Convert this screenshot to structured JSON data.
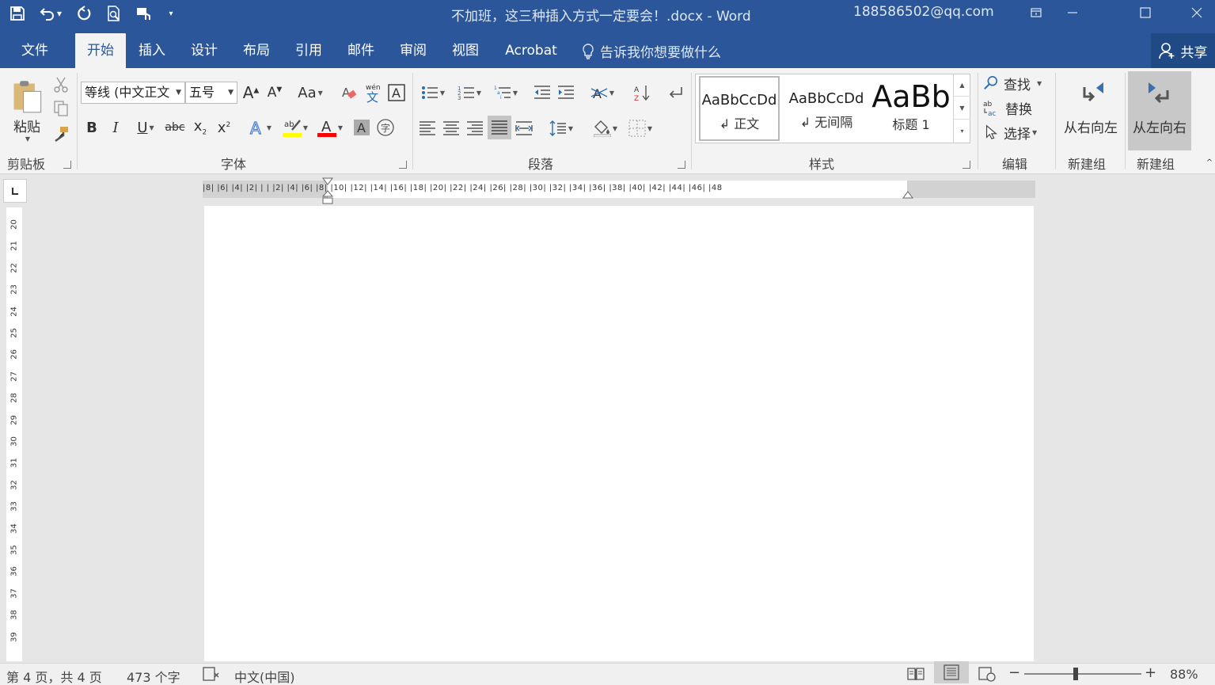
{
  "titlebar": {
    "document_title": "不加班，这三种插入方式一定要会！.docx  -  Word",
    "user_email": "188586502@qq.com",
    "qat_icons": [
      "save-icon",
      "undo-icon",
      "redo-icon",
      "print-preview-icon",
      "touch-mode-icon",
      "customize-qat-icon"
    ]
  },
  "tabs": {
    "file": "文件",
    "home": "开始",
    "insert": "插入",
    "design": "设计",
    "layout": "布局",
    "references": "引用",
    "mailings": "邮件",
    "review": "审阅",
    "view": "视图",
    "acrobat": "Acrobat",
    "tell_me": "告诉我你想要做什么",
    "share": "共享"
  },
  "ribbon": {
    "clipboard": {
      "paste": "粘贴",
      "label": "剪贴板"
    },
    "font": {
      "font_name": "等线 (中文正文",
      "font_size": "五号",
      "case_label": "Aa",
      "label": "字体"
    },
    "paragraph": {
      "label": "段落"
    },
    "styles": {
      "items": [
        {
          "preview": "AaBbCcDd",
          "name": "正文"
        },
        {
          "preview": "AaBbCcDd",
          "name": "无间隔"
        },
        {
          "preview": "AaBb",
          "name": "标题 1"
        }
      ],
      "label": "样式"
    },
    "editing": {
      "find": "查找",
      "replace": "替换",
      "select": "选择",
      "label": "编辑"
    },
    "rtl_group": {
      "button": "从右向左",
      "label": "新建组"
    },
    "ltr_group": {
      "button": "从左向右",
      "label": "新建组"
    }
  },
  "ruler": {
    "horizontal": "|8|  |6|  |4|  |2|  |   |  |2|  |4|  |6|  |8|  |10|  |12|  |14|  |16|  |18|  |20|  |22|  |24|  |26|  |28|  |30|  |32|  |34|  |36|  |38|  |40|  |42|  |44|  |46|  |48",
    "vertical": [
      "20",
      "21",
      "22",
      "23",
      "24",
      "25",
      "26",
      "27",
      "28",
      "29",
      "30",
      "31",
      "32",
      "33",
      "34",
      "35",
      "36",
      "37",
      "38",
      "39"
    ]
  },
  "statusbar": {
    "page_info": "第 4 页，共 4 页",
    "word_count": "473 个字",
    "language": "中文(中国)",
    "zoom": "88%",
    "zoom_level": 0.88
  },
  "colors": {
    "accent": "#2b579a",
    "highlight": "#ffff00",
    "font_color": "#ff0000"
  }
}
